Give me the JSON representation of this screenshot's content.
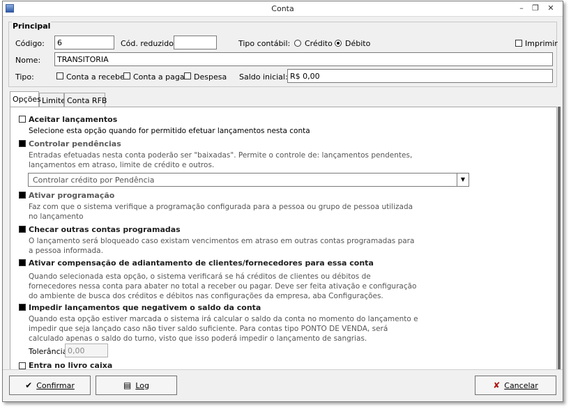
{
  "window": {
    "title": "Conta"
  },
  "principal": {
    "group_title": "Principal",
    "codigo_label": "Código:",
    "codigo_value": "6",
    "cod_reduzido_label": "Cód. reduzido:",
    "cod_reduzido_value": "",
    "tipo_contabil_label": "Tipo contábil:",
    "credito_label": "Crédito",
    "debito_label": "Débito",
    "tipo_contabil_selected": "Débito",
    "imprimir_label": "Imprimir",
    "nome_label": "Nome:",
    "nome_value": "TRANSITORIA",
    "tipo_label": "Tipo:",
    "conta_receber_label": "Conta a receber",
    "conta_pagar_label": "Conta a pagar",
    "despesa_label": "Despesa",
    "saldo_inicial_label": "Saldo inicial:",
    "saldo_inicial_value": "R$ 0,00"
  },
  "tabs": [
    {
      "label": "Opções",
      "active": true
    },
    {
      "label": "Limite",
      "active": false
    },
    {
      "label": "Conta RFB",
      "active": false
    }
  ],
  "options": {
    "aceitar": {
      "title": "Aceitar lançamentos",
      "desc": "Selecione esta opção quando for permitido efetuar lançamentos nesta conta"
    },
    "controlar": {
      "title": "Controlar pendências",
      "desc": "Entradas efetuadas nesta conta poderão ser \"baixadas\". Permite o controle de: lançamentos pendentes, lançamentos em atraso, limite de crédito e outros.",
      "select_value": "Controlar crédito por Pendência"
    },
    "programacao": {
      "title": "Ativar programação",
      "desc": "Faz com que o sistema verifique a programação configurada para a pessoa ou grupo de pessoa utilizada no lançamento"
    },
    "checar": {
      "title": "Checar outras contas programadas",
      "desc": "O lançamento será bloqueado caso existam vencimentos em atraso em outras contas programadas para a pessoa informada."
    },
    "compensacao": {
      "title": "Ativar compensação de adiantamento de clientes/fornecedores para essa conta",
      "desc": "Quando  selecionada esta opção, o sistema verificará se há créditos de clientes ou débitos de fornecedores nessa conta para abater no total a receber ou pagar. Deve ser feita ativação e configuração do ambiente de busca dos créditos e débitos nas configurações da empresa, aba Configurações."
    },
    "impedir": {
      "title": "Impedir lançamentos que negativem o saldo da conta",
      "desc": "Quando esta opção estiver marcada o sistema irá calcular o saldo da conta no momento do lançamento e impedir que seja lançado caso não tiver saldo suficiente. Para contas tipo PONTO DE VENDA, será calculado apenas o saldo do turno, visto que isso poderá impedir o lançamento de sangrias.",
      "tolerancia_label": "Tolerância:",
      "tolerancia_value": "0,00"
    },
    "livro_caixa": {
      "title": "Entra no livro caixa"
    }
  },
  "footer": {
    "confirmar_label": "Confirmar",
    "log_label": "Log",
    "cancelar_label": "Cancelar"
  }
}
